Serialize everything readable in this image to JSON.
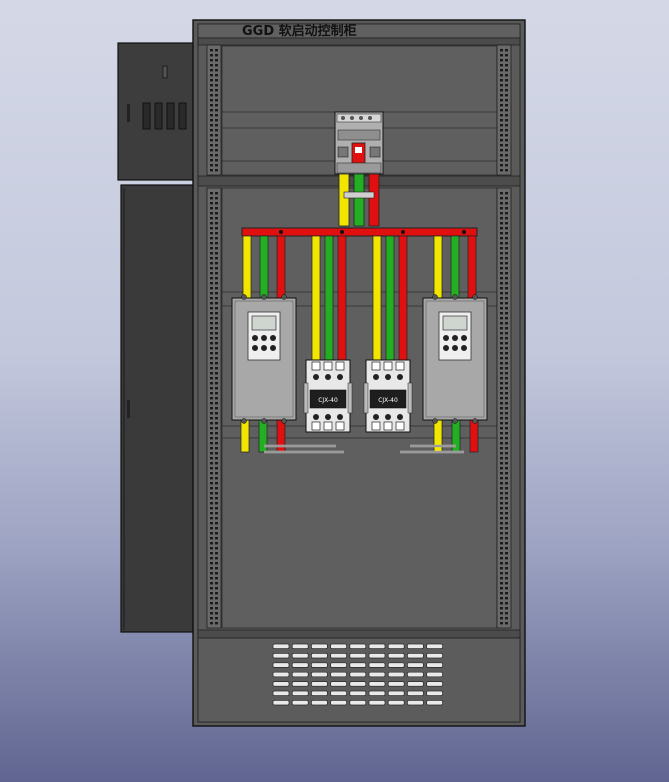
{
  "cabinet": {
    "title": "GGD  软启动控制柜",
    "starter_count": 2,
    "contactor_count": 2,
    "contactor_label": "CJX-40",
    "vent_rows": 7,
    "vent_cols": 9
  },
  "colors": {
    "background_top": "#d4d8e6",
    "background_bottom": "#5f6590",
    "cabinet_body": "#5a5a5a",
    "door": "#3d3d3d",
    "phase_a": "#f2e600",
    "phase_b": "#22b022",
    "phase_c": "#e01010",
    "busbar": "#e01010",
    "device_body": "#a8a8a8",
    "title_text": "#111111"
  },
  "icons": {
    "door_lock": "lock-icon",
    "keypad": "keypad-icon",
    "breaker_switch": "toggle-icon"
  }
}
